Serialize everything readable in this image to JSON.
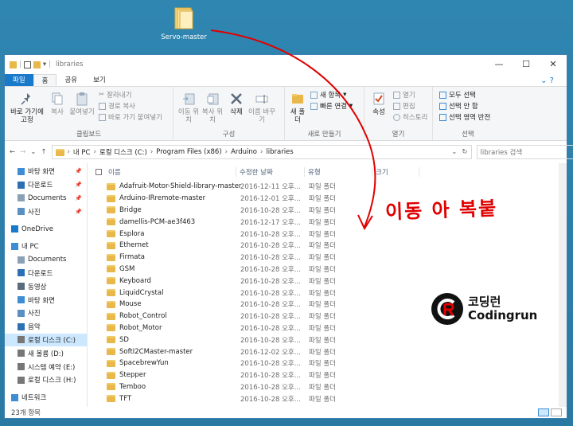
{
  "desktop": {
    "icon_label": "Servo-master"
  },
  "window": {
    "title": "libraries",
    "controls": {
      "minimize": "—",
      "maximize": "☐",
      "close": "✕"
    }
  },
  "ribbon_tabs": [
    "파일",
    "홈",
    "공유",
    "보기"
  ],
  "ribbon": {
    "clipboard": {
      "pin_label": "바로 가기에 고정",
      "copy_label": "복사",
      "paste_label": "붙여넣기",
      "cut": "잘라내기",
      "copy_path": "경로 복사",
      "paste_shortcut": "바로 가기 붙여넣기",
      "group_label": "클립보드"
    },
    "organize": {
      "move_to": "이동 위치",
      "copy_to": "복사 위치",
      "delete": "삭제",
      "rename": "이름 바꾸기",
      "group_label": "구성"
    },
    "new": {
      "new_folder": "새 폴더",
      "new_item": "새 항목",
      "easy_access": "빠른 연결",
      "group_label": "새로 만들기"
    },
    "open": {
      "properties": "속성",
      "open": "열기",
      "edit": "편집",
      "history": "히스토리",
      "group_label": "열기"
    },
    "select": {
      "select_all": "모두 선택",
      "select_none": "선택 안 함",
      "invert": "선택 영역 반전",
      "group_label": "선택"
    }
  },
  "address": {
    "crumbs": [
      "내 PC",
      "로컬 디스크 (C:)",
      "Program Files (x86)",
      "Arduino",
      "libraries"
    ],
    "search_placeholder": "libraries 검색"
  },
  "nav": [
    {
      "label": "바탕 화면",
      "icon": "desktop-icon",
      "pinned": true,
      "level": 1
    },
    {
      "label": "다운로드",
      "icon": "download-icon",
      "pinned": true,
      "level": 1
    },
    {
      "label": "Documents",
      "icon": "documents-icon",
      "pinned": true,
      "level": 1
    },
    {
      "label": "사진",
      "icon": "pictures-icon",
      "pinned": true,
      "level": 1
    },
    {
      "label": "",
      "icon": "",
      "pinned": false,
      "level": -1
    },
    {
      "label": "OneDrive",
      "icon": "cloud-icon",
      "pinned": false,
      "level": 0
    },
    {
      "label": "",
      "icon": "",
      "pinned": false,
      "level": -1
    },
    {
      "label": "내 PC",
      "icon": "pc-icon",
      "pinned": false,
      "level": 0
    },
    {
      "label": "Documents",
      "icon": "documents-icon",
      "pinned": false,
      "level": 1
    },
    {
      "label": "다운로드",
      "icon": "download-icon",
      "pinned": false,
      "level": 1
    },
    {
      "label": "동영상",
      "icon": "video-icon",
      "pinned": false,
      "level": 1
    },
    {
      "label": "바탕 화면",
      "icon": "desktop-icon",
      "pinned": false,
      "level": 1
    },
    {
      "label": "사진",
      "icon": "pictures-icon",
      "pinned": false,
      "level": 1
    },
    {
      "label": "음악",
      "icon": "music-icon",
      "pinned": false,
      "level": 1
    },
    {
      "label": "로컬 디스크 (C:)",
      "icon": "drive-icon",
      "pinned": false,
      "level": 1,
      "selected": true
    },
    {
      "label": "새 볼륨 (D:)",
      "icon": "drive-icon",
      "pinned": false,
      "level": 1
    },
    {
      "label": "시스템 예약 (E:)",
      "icon": "drive-icon",
      "pinned": false,
      "level": 1
    },
    {
      "label": "로컬 디스크 (H:)",
      "icon": "drive-icon",
      "pinned": false,
      "level": 1
    },
    {
      "label": "",
      "icon": "",
      "pinned": false,
      "level": -1
    },
    {
      "label": "네트워크",
      "icon": "network-icon",
      "pinned": false,
      "level": 0
    }
  ],
  "columns": {
    "name": "이름",
    "date": "수정한 날짜",
    "type": "유형",
    "size": "크기"
  },
  "files": [
    {
      "name": "Adafruit-Motor-Shield-library-master",
      "date": "2016-12-11 오후...",
      "type": "파일 폴더"
    },
    {
      "name": "Arduino-IRremote-master",
      "date": "2016-12-01 오후...",
      "type": "파일 폴더"
    },
    {
      "name": "Bridge",
      "date": "2016-10-28 오후...",
      "type": "파일 폴더"
    },
    {
      "name": "damellis-PCM-ae3f463",
      "date": "2016-12-17 오후...",
      "type": "파일 폴더"
    },
    {
      "name": "Esplora",
      "date": "2016-10-28 오후...",
      "type": "파일 폴더"
    },
    {
      "name": "Ethernet",
      "date": "2016-10-28 오후...",
      "type": "파일 폴더"
    },
    {
      "name": "Firmata",
      "date": "2016-10-28 오후...",
      "type": "파일 폴더"
    },
    {
      "name": "GSM",
      "date": "2016-10-28 오후...",
      "type": "파일 폴더"
    },
    {
      "name": "Keyboard",
      "date": "2016-10-28 오후...",
      "type": "파일 폴더"
    },
    {
      "name": "LiquidCrystal",
      "date": "2016-10-28 오후...",
      "type": "파일 폴더"
    },
    {
      "name": "Mouse",
      "date": "2016-10-28 오후...",
      "type": "파일 폴더"
    },
    {
      "name": "Robot_Control",
      "date": "2016-10-28 오후...",
      "type": "파일 폴더"
    },
    {
      "name": "Robot_Motor",
      "date": "2016-10-28 오후...",
      "type": "파일 폴더"
    },
    {
      "name": "SD",
      "date": "2016-10-28 오후...",
      "type": "파일 폴더"
    },
    {
      "name": "SoftI2CMaster-master",
      "date": "2016-12-02 오후...",
      "type": "파일 폴더"
    },
    {
      "name": "SpacebrewYun",
      "date": "2016-10-28 오후...",
      "type": "파일 폴더"
    },
    {
      "name": "Stepper",
      "date": "2016-10-28 오후...",
      "type": "파일 폴더"
    },
    {
      "name": "Temboo",
      "date": "2016-10-28 오후...",
      "type": "파일 폴더"
    },
    {
      "name": "TFT",
      "date": "2016-10-28 오후...",
      "type": "파일 폴더"
    }
  ],
  "status": {
    "item_count": "23개 항목"
  },
  "annotation": {
    "handwritten": "이동 아 복붙",
    "arrow_color": "#e00000"
  },
  "logo": {
    "line1": "코딩런",
    "line2": "Codingrun"
  },
  "colors": {
    "accent": "#1979ca",
    "folder": "#e8b84a",
    "selection": "#cce8ff",
    "desktop": "#2b7da8"
  }
}
